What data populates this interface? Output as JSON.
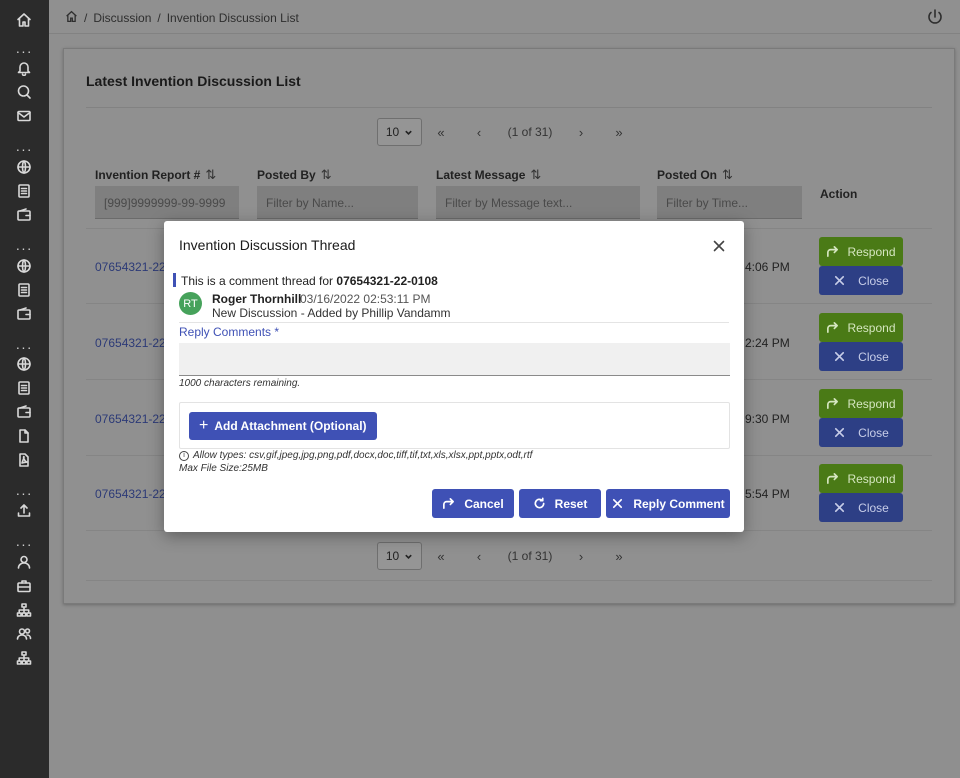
{
  "sidebar": {
    "icons": [
      "home-icon",
      "more-icon",
      "bell-icon",
      "search-chat-icon",
      "mail-icon",
      "more-icon",
      "globe-icon",
      "document-icon",
      "wallet-icon",
      "more-icon",
      "globe-icon",
      "document-icon",
      "wallet-icon",
      "more-icon",
      "globe-icon",
      "document-icon",
      "wallet-icon",
      "file-icon",
      "pdf-icon",
      "more-icon",
      "upload-icon",
      "more-icon",
      "user-icon",
      "briefcase-icon",
      "org-chart-icon",
      "users-icon",
      "hierarchy-icon"
    ]
  },
  "breadcrumb": {
    "sep": "/",
    "section": "Discussion",
    "page": "Invention Discussion List"
  },
  "card": {
    "title": "Latest Invention Discussion List"
  },
  "pager": {
    "size": "10",
    "first": "«",
    "prev": "‹",
    "info": "(1 of 31)",
    "next": "›",
    "last": "»"
  },
  "table": {
    "headers": {
      "report": "Invention Report #",
      "posted_by": "Posted By",
      "latest": "Latest Message",
      "posted_on": "Posted On",
      "action": "Action"
    },
    "filters": {
      "report": "[999]9999999-99-9999",
      "posted_by": "Filter by Name...",
      "latest": "Filter by Message text...",
      "posted_on": "Filter by Time..."
    },
    "rows": [
      {
        "report": "07654321-22-",
        "time": "4:06 PM"
      },
      {
        "report": "07654321-22-",
        "time": "2:24 PM"
      },
      {
        "report": "07654321-22-",
        "time": "9:30 PM"
      },
      {
        "report": "07654321-22-",
        "time": "5:54 PM"
      }
    ],
    "respond_label": "Respond",
    "close_label": "Close"
  },
  "modal": {
    "title": "Invention Discussion Thread",
    "thread_prefix": "This is a comment thread for ",
    "thread_id": "07654321-22-0108",
    "avatar": "RT",
    "author": "Roger Thornhill",
    "date": "03/16/2022 02:53:11 PM",
    "message": "New Discussion - Added by Phillip Vandamm",
    "reply_label": "Reply Comments *",
    "reply_value": "",
    "chars_remaining": "1000 characters remaining.",
    "attach_label": "Add Attachment (Optional)",
    "allow_types": "Allow types: csv,gif,jpeg,jpg,png,pdf,docx,doc,tiff,tif,txt,xls,xlsx,ppt,pptx,odt,rtf",
    "max_size": "Max File Size:25MB",
    "cancel_label": "Cancel",
    "reset_label": "Reset",
    "reply_btn_label": "Reply Comment"
  }
}
